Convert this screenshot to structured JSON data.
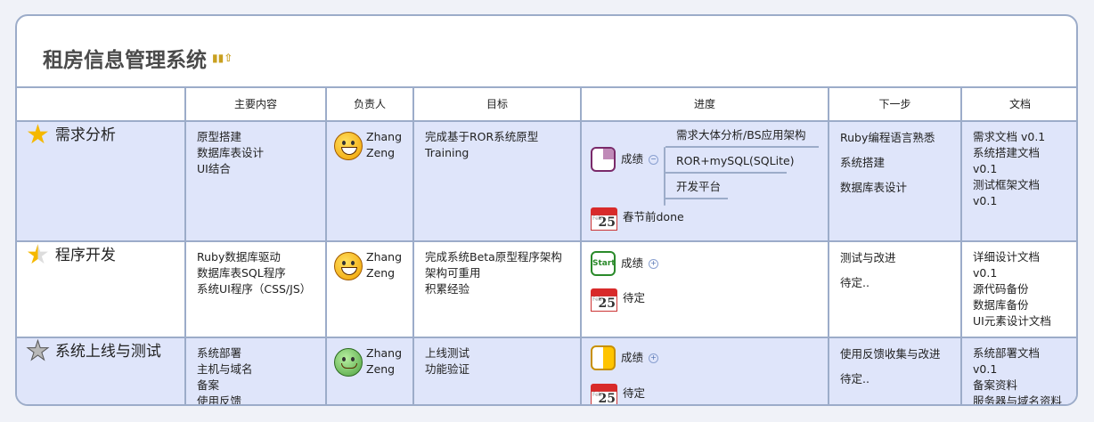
{
  "title": "租房信息管理系统",
  "headers": [
    "",
    "主要内容",
    "负责人",
    "目标",
    "进度",
    "下一步",
    "文档"
  ],
  "rows": [
    {
      "name": "需求分析",
      "star": "gold-star-icon",
      "content": [
        "原型搭建",
        "数据库表设计",
        "UI结合"
      ],
      "person": [
        "Zhang",
        "Zeng"
      ],
      "goal": [
        "完成基于ROR系统原型",
        "Training"
      ],
      "progress": {
        "label": "成绩",
        "branches": [
          "需求大体分析/BS应用架构",
          "ROR+mySQL(SQLite)",
          "开发平台"
        ],
        "date": "春节前done"
      },
      "next": [
        "Ruby编程语言熟悉",
        "系统搭建",
        "数据库表设计"
      ],
      "docs": [
        "需求文档 v0.1",
        "系统搭建文档 v0.1",
        "测试框架文档 v0.1"
      ]
    },
    {
      "name": "程序开发",
      "star": "half-star-icon",
      "content": [
        "Ruby数据库驱动",
        "数据库表SQL程序",
        "系统UI程序（CSS/JS）"
      ],
      "person": [
        "Zhang",
        "Zeng"
      ],
      "goal": [
        "完成系统Beta原型程序架构",
        "架构可重用",
        "积累经验"
      ],
      "progress": {
        "label": "成绩",
        "badge": "Start",
        "date": "待定"
      },
      "next": [
        "测试与改进",
        "待定.."
      ],
      "docs": [
        "详细设计文档 v0.1",
        "源代码备份",
        "数据库备份",
        "UI元素设计文档"
      ]
    },
    {
      "name": "系统上线与测试",
      "star": "empty-star-icon",
      "content": [
        "系统部署",
        "主机与域名",
        "备案",
        "使用反馈"
      ],
      "person": [
        "Zhang",
        "Zeng"
      ],
      "goal": [
        "上线测试",
        "功能验证"
      ],
      "progress": {
        "label": "成绩",
        "date": "待定"
      },
      "next": [
        "使用反馈收集与改进",
        "待定.."
      ],
      "docs": [
        "系统部署文档 v0.1",
        "备案资料",
        "服务器与域名资料"
      ]
    }
  ],
  "calendar": {
    "month": "Feb",
    "day": "25"
  },
  "colors": {
    "border": "#9cacc9",
    "row_blue": "#dfe5fa"
  }
}
